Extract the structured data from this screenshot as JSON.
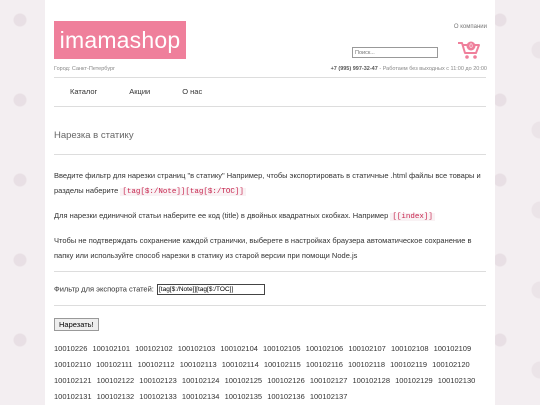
{
  "header": {
    "logo_text": "imamashop",
    "about_link": "О компании",
    "search_placeholder": "Поиск...",
    "city": "Город: Санкт-Петербург",
    "phone": "+7 (995) 997-32-47",
    "hours": " - Работаем без выходных с 11:00 до 20:00",
    "cart_count": "0",
    "accent_color": "#ef7f9b"
  },
  "nav": {
    "items": [
      "Каталог",
      "Акции",
      "О нас"
    ]
  },
  "main": {
    "title": "Нарезка в статику",
    "para1_text": "Введите фильтр для нарезки страниц \"в статику\" Например, чтобы экспортировать в статичные .html файлы все товары и разделы наберите",
    "para1_code": "[tag[$:/Note]][tag[$:/TOC]]",
    "para2_text": "Для нарезки единичной статьи наберите ее код (title) в двойных квадратных скобках. Например",
    "para2_code": "[[index]]",
    "para3_text": "Чтобы не подтверждать сохранение каждой странички, выберете в настройках браузера автоматическое сохранение в папку или используйте способ нарезки в статику из старой версии при помощи Node.js",
    "filter_label": "Фильтр для экспорта статей:",
    "filter_value": "[tag[$:/Note]][tag[$:/TOC]]",
    "button_label": "Нарезать!",
    "ids": [
      "10010226",
      "100102101",
      "100102102",
      "100102103",
      "100102104",
      "100102105",
      "100102106",
      "100102107",
      "100102108",
      "100102109",
      "100102110",
      "100102111",
      "100102112",
      "100102113",
      "100102114",
      "100102115",
      "100102116",
      "100102118",
      "100102119",
      "100102120",
      "100102121",
      "100102122",
      "100102123",
      "100102124",
      "100102125",
      "100102126",
      "100102127",
      "100102128",
      "100102129",
      "100102130",
      "100102131",
      "100102132",
      "100102133",
      "100102134",
      "100102135",
      "100102136",
      "100102137"
    ]
  }
}
